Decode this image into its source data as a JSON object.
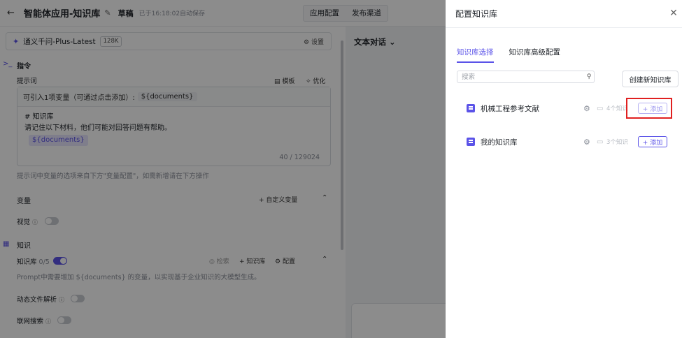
{
  "topbar": {
    "back_icon": "arrow-left-icon",
    "title": "智能体应用-知识库",
    "draft": "草稿",
    "saved": "已于16:18:02自动保存",
    "tabs": [
      "应用配置",
      "发布渠道"
    ]
  },
  "model": {
    "name": "通义千问-Plus-Latest",
    "context": "128K",
    "settings_label": "设置"
  },
  "instructions": {
    "heading": "指令",
    "prompt_label": "提示词",
    "template_label": "模板",
    "optimize_label": "优化",
    "variable_hint": "可引入1项变量（可通过点击添加）:",
    "variable": "${documents}",
    "body_line1": "# 知识库",
    "body_line2": "请记住以下材料，他们可能对回答问题有帮助。",
    "body_var": "${documents}",
    "counter": "40 / 129024",
    "footer_hint": "提示词中变量的选项来自下方\"变量配置\"，如需新增请在下方操作"
  },
  "variables": {
    "heading": "变量",
    "custom_label": "自定义变量",
    "vision_label": "视觉"
  },
  "knowledge": {
    "heading": "知识",
    "kb_label": "知识库",
    "kb_count": "0/5",
    "retrieve_label": "检索",
    "add_kb_label": "知识库",
    "config_label": "配置",
    "desc": "Prompt中需要增加 ${documents} 的变量，以实现基于企业知识的大模型生成。",
    "dynamic_label": "动态文件解析",
    "web_search_label": "联网搜索"
  },
  "chat": {
    "title": "文本对话"
  },
  "drawer": {
    "title": "配置知识库",
    "tabs": [
      "知识库选择",
      "知识库高级配置"
    ],
    "active_tab": 0,
    "search_placeholder": "搜索",
    "create_label": "创建新知识库",
    "items": [
      {
        "name": "机械工程参考文献",
        "count": "4个知识",
        "add_label": "+ 添加"
      },
      {
        "name": "我的知识库",
        "count": "3个知识",
        "add_label": "+ 添加"
      }
    ],
    "accent_color": "#5b53e8",
    "highlight_color": "#e02020"
  }
}
